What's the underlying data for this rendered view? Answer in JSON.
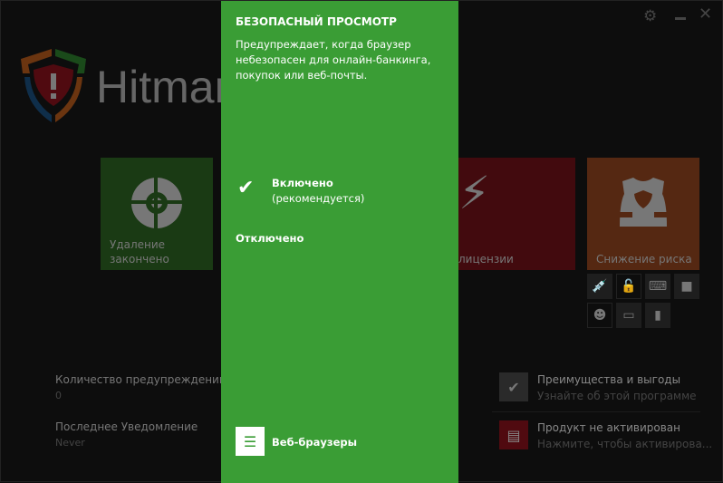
{
  "app": {
    "name": "Hitman"
  },
  "window": {
    "settings_icon": "gear-icon",
    "minimize_icon": "minimize-icon",
    "close_icon": "close-icon"
  },
  "tiles": [
    {
      "label": "Удаление законченo",
      "color": "#1a3a14"
    },
    {
      "label": "лицензии",
      "color": "#420a0e"
    },
    {
      "label": "Снижение риска",
      "color": "#552812"
    }
  ],
  "small_icons": [
    "syringe-icon",
    "lock-icon",
    "keyboard-icon",
    "webcam-icon",
    "pumpkin-icon",
    "console-icon",
    "usb-icon"
  ],
  "stats": [
    {
      "label": "Количество предупреждений",
      "value": "0"
    },
    {
      "label": "Последнее Уведомление",
      "value": "Never"
    }
  ],
  "side_links": [
    {
      "title": "Преимущества и выгоды",
      "subtitle": "Узнайте об этой программе"
    },
    {
      "title": "Продукт не активирован",
      "subtitle": "Нажмите, чтобы активирова..."
    }
  ],
  "panel": {
    "title": "БЕЗОПАСНЫЙ ПРОСМОТР",
    "description": "Предупреждает, когда браузер небезопасен для онлайн-банкинга, покупок или веб-почты.",
    "option_on": "Включено",
    "option_on_note": "(рекомендуется)",
    "option_off": "Отключено",
    "footer_link": "Веб-браузеры",
    "color": "#3a9d35"
  }
}
